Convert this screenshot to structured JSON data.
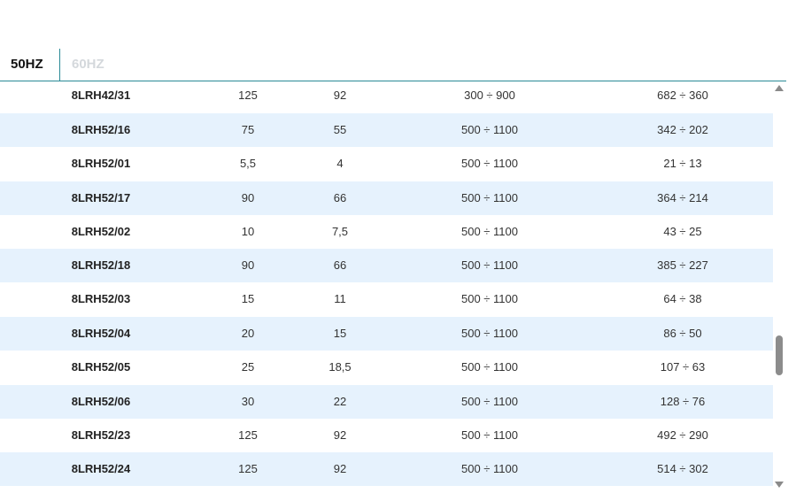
{
  "tabs": [
    {
      "label": "50HZ",
      "active": true
    },
    {
      "label": "60HZ",
      "active": false
    }
  ],
  "rows": [
    {
      "model": "8LRH42/31",
      "kw": "125",
      "hp": "92",
      "range1": "300 ÷ 900",
      "range2": "682 ÷ 360"
    },
    {
      "model": "8LRH52/16",
      "kw": "75",
      "hp": "55",
      "range1": "500 ÷ 1100",
      "range2": "342 ÷ 202"
    },
    {
      "model": "8LRH52/01",
      "kw": "5,5",
      "hp": "4",
      "range1": "500 ÷ 1100",
      "range2": "21 ÷ 13"
    },
    {
      "model": "8LRH52/17",
      "kw": "90",
      "hp": "66",
      "range1": "500 ÷ 1100",
      "range2": "364 ÷ 214"
    },
    {
      "model": "8LRH52/02",
      "kw": "10",
      "hp": "7,5",
      "range1": "500 ÷ 1100",
      "range2": "43 ÷ 25"
    },
    {
      "model": "8LRH52/18",
      "kw": "90",
      "hp": "66",
      "range1": "500 ÷ 1100",
      "range2": "385 ÷ 227"
    },
    {
      "model": "8LRH52/03",
      "kw": "15",
      "hp": "11",
      "range1": "500 ÷ 1100",
      "range2": "64 ÷ 38"
    },
    {
      "model": "8LRH52/04",
      "kw": "20",
      "hp": "15",
      "range1": "500 ÷ 1100",
      "range2": "86 ÷ 50"
    },
    {
      "model": "8LRH52/05",
      "kw": "25",
      "hp": "18,5",
      "range1": "500 ÷ 1100",
      "range2": "107 ÷ 63"
    },
    {
      "model": "8LRH52/06",
      "kw": "30",
      "hp": "22",
      "range1": "500 ÷ 1100",
      "range2": "128 ÷ 76"
    },
    {
      "model": "8LRH52/23",
      "kw": "125",
      "hp": "92",
      "range1": "500 ÷ 1100",
      "range2": "492 ÷ 290"
    },
    {
      "model": "8LRH52/24",
      "kw": "125",
      "hp": "92",
      "range1": "500 ÷ 1100",
      "range2": "514 ÷ 302"
    }
  ],
  "colors": {
    "accent": "#2a8a96",
    "row_alt": "#e6f2fd",
    "inactive_tab": "#d4d8dc"
  },
  "icons": {
    "scroll_up": "arrow-up-icon",
    "scroll_down": "arrow-down-icon"
  }
}
